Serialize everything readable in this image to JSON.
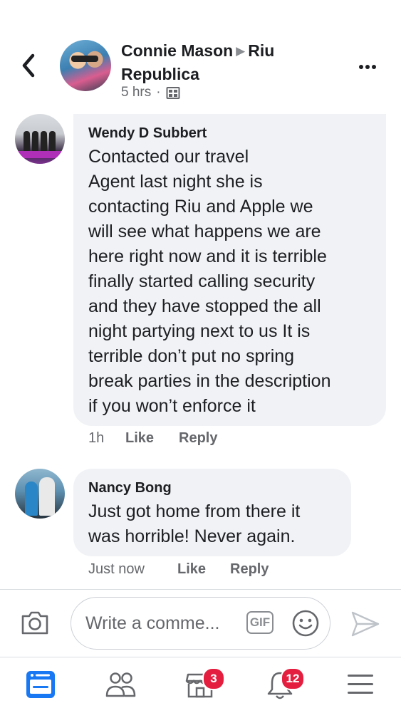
{
  "post": {
    "author": "Connie Mason",
    "target": "Riu Republica",
    "time": "5 hrs",
    "separator": "·"
  },
  "comments": [
    {
      "author": "Wendy D Subbert",
      "text": "Contacted our travel\nAgent last night she is\ncontacting Riu and Apple we\nwill see what happens we are\nhere right now and it is terrible\nfinally started calling security\nand they have stopped the all\nnight partying next to us   It is\nterrible don’t put no spring\nbreak parties in the description\nif you won’t enforce it",
      "time": "1h",
      "like_label": "Like",
      "reply_label": "Reply"
    },
    {
      "author": "Nancy Bong",
      "text": "Just got home from there it\nwas horrible! Never again.",
      "time": "Just now",
      "like_label": "Like",
      "reply_label": "Reply"
    }
  ],
  "composer": {
    "placeholder": "Write a comme...",
    "gif_label": "GIF"
  },
  "nav": {
    "items": [
      {
        "icon": "news-feed-icon",
        "active": true
      },
      {
        "icon": "friends-icon"
      },
      {
        "icon": "marketplace-icon",
        "badge": "3"
      },
      {
        "icon": "notifications-icon",
        "badge": "12"
      },
      {
        "icon": "menu-icon"
      }
    ]
  },
  "colors": {
    "accent": "#1877f2",
    "badge": "#e41e3f",
    "bubble": "#f0f2f5",
    "secondary_text": "#65676b"
  }
}
